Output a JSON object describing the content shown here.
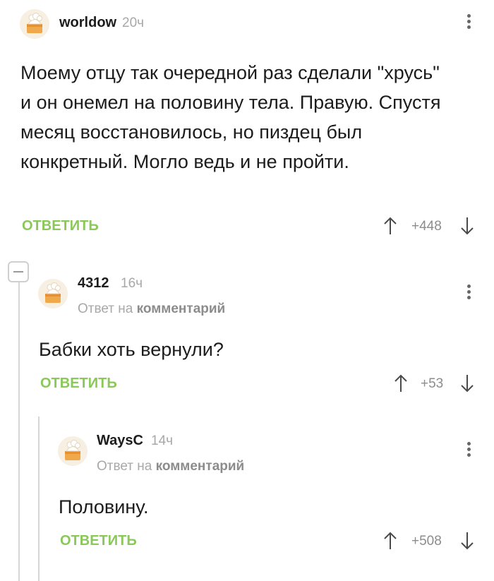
{
  "comments": [
    {
      "username": "worldow",
      "time": "20ч",
      "text": "Моему отцу так очередной раз сделали \"хрусь\" и он онемел на половину тела. Правую. Спустя месяц восстановилось, но пиздец был конкретный. Могло ведь и не пройти.",
      "reply_label": "ОТВЕТИТЬ",
      "rating": "+448"
    },
    {
      "username": "4312",
      "time": "16ч",
      "reply_to_prefix": "Ответ на",
      "reply_to_target": "комментарий",
      "text": "Бабки хоть вернули?",
      "reply_label": "ОТВЕТИТЬ",
      "rating": "+53"
    },
    {
      "username": "WaysC",
      "time": "14ч",
      "reply_to_prefix": "Ответ на",
      "reply_to_target": "комментарий",
      "text": "Половину.",
      "reply_label": "ОТВЕТИТЬ",
      "rating": "+508"
    }
  ],
  "colors": {
    "reply_green": "#8ac858",
    "thread_line": "#d6d6d6",
    "muted_text": "#a8a8a8"
  },
  "icons": [
    "avatar-icon",
    "more-options-icon",
    "upvote-arrow-icon",
    "downvote-arrow-icon",
    "collapse-thread-icon"
  ]
}
